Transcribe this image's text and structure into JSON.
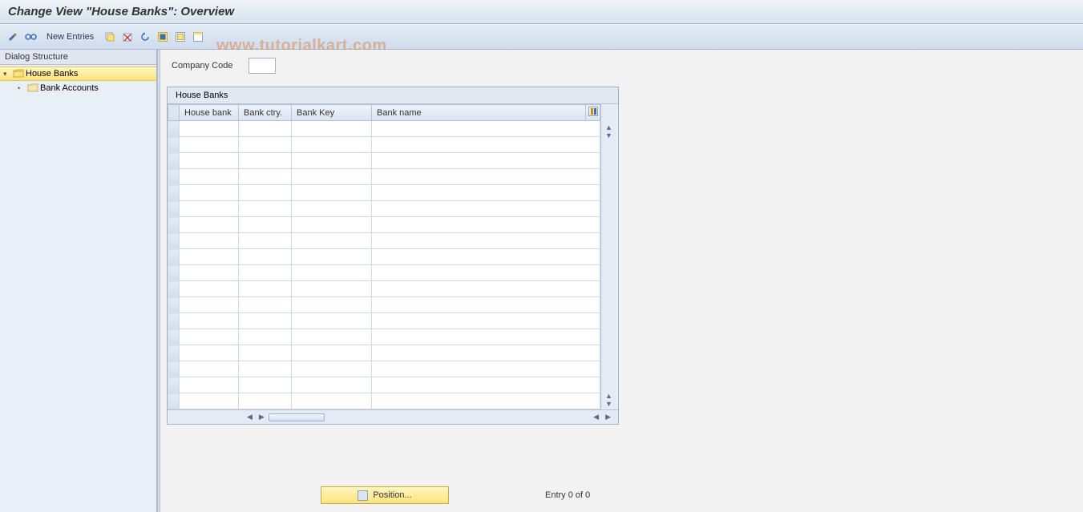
{
  "title": "Change View \"House Banks\": Overview",
  "toolbar": {
    "new_entries": "New Entries",
    "icons": {
      "toggle": "toggle-icon",
      "glasses": "glasses-icon",
      "copy": "copy-icon",
      "save": "save-icon",
      "undo": "undo-icon",
      "select_all": "select-all-icon",
      "deselect": "deselect-icon",
      "layout": "layout-icon"
    }
  },
  "sidebar": {
    "title": "Dialog Structure",
    "items": [
      {
        "label": "House Banks",
        "selected": true,
        "icon": "folder-open-icon"
      },
      {
        "label": "Bank Accounts",
        "selected": false,
        "icon": "folder-closed-icon"
      }
    ]
  },
  "form": {
    "company_code_label": "Company Code",
    "company_code_value": ""
  },
  "table": {
    "title": "House Banks",
    "columns": [
      "House bank",
      "Bank ctry.",
      "Bank Key",
      "Bank name"
    ],
    "rows": 18
  },
  "footer": {
    "position_label": "Position...",
    "entry_text": "Entry 0 of 0"
  },
  "watermark": "www.tutorialkart.com"
}
